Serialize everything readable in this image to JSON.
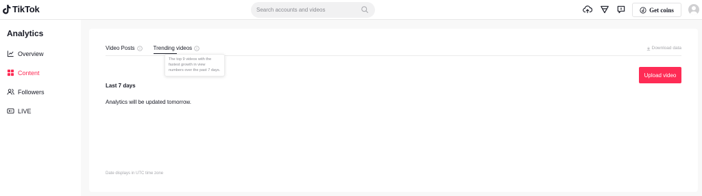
{
  "header": {
    "logo_text": "TikTok",
    "search_placeholder": "Search accounts and videos",
    "get_coins_label": "Get coins",
    "icons": [
      "upload-cloud-icon",
      "inbox-filter-icon",
      "message-icon",
      "coin-icon",
      "avatar"
    ]
  },
  "sidebar": {
    "title": "Analytics",
    "items": [
      {
        "label": "Overview",
        "icon": "chart-line-icon",
        "active": false
      },
      {
        "label": "Content",
        "icon": "grid-icon",
        "active": true
      },
      {
        "label": "Followers",
        "icon": "users-icon",
        "active": false
      },
      {
        "label": "LIVE",
        "icon": "live-icon",
        "active": false
      }
    ]
  },
  "main": {
    "tabs": [
      {
        "label": "Video Posts",
        "active": false
      },
      {
        "label": "Trending videos",
        "active": true
      }
    ],
    "download_label": "Download data",
    "tooltip": "The top 9 videos with the fastest growth in view numbers over the past 7 days.",
    "upload_label": "Upload video",
    "period_label": "Last 7 days",
    "notice": "Analytics will be updated tomorrow.",
    "footnote": "Date displays in UTC time zone"
  },
  "colors": {
    "accent": "#fe2c55",
    "text": "#161823",
    "muted": "#a5a6ab",
    "background": "#f8f8f8"
  }
}
